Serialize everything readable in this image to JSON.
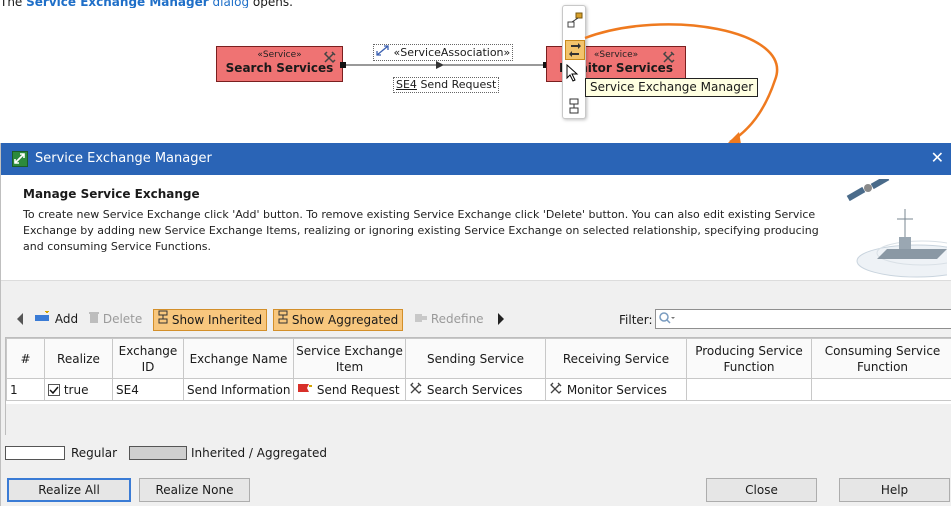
{
  "doc": {
    "prefix": "The ",
    "link_bold": "Service Exchange Manager",
    "link": " dialog",
    "suffix": " opens."
  },
  "diagram": {
    "left_service": {
      "stereotype": "«Service»",
      "name": "Search Services"
    },
    "right_service": {
      "stereotype": "«Service»",
      "name": "Monitor Services"
    },
    "association_label": "«ServiceAssociation»",
    "exchange_id": "SE4",
    "exchange_label": "Send Request",
    "tooltip": "Service Exchange Manager",
    "connector_color": "#ef7a1f"
  },
  "dialog": {
    "title": "Service Exchange Manager",
    "header_title": "Manage Service Exchange",
    "header_desc": "To create new Service Exchange click 'Add' button. To remove existing Service Exchange click 'Delete' button. You can also edit existing Service Exchange by adding new Service Exchange Items, realizing or ignoring existing Service Exchange on selected relationship, specifying producing and consuming Service Functions.",
    "toolbar": {
      "add": "Add",
      "delete": "Delete",
      "show_inherited": "Show Inherited",
      "show_aggregated": "Show Aggregated",
      "redefine": "Redefine",
      "filter_label": "Filter:"
    },
    "columns": [
      "#",
      "Realize",
      "Exchange ID",
      "Exchange Name",
      "Service Exchange Item",
      "Sending Service",
      "Receiving Service",
      "Producing Service Function",
      "Consuming Service Function"
    ],
    "rows": [
      {
        "num": "1",
        "realize": "true",
        "exchange_id": "SE4",
        "exchange_name": "Send Information",
        "item": "Send Request",
        "sending": "Search Services",
        "receiving": "Monitor Services",
        "producing": "",
        "consuming": ""
      }
    ],
    "legend": {
      "regular": "Regular",
      "inherited": "Inherited / Aggregated"
    },
    "buttons": {
      "realize_all": "Realize All",
      "realize_none": "Realize None",
      "close": "Close",
      "help": "Help"
    },
    "colors": {
      "titlebar": "#2a64b6",
      "toggle_on": "#f8c77e",
      "service_fill": "#ef7373"
    }
  }
}
